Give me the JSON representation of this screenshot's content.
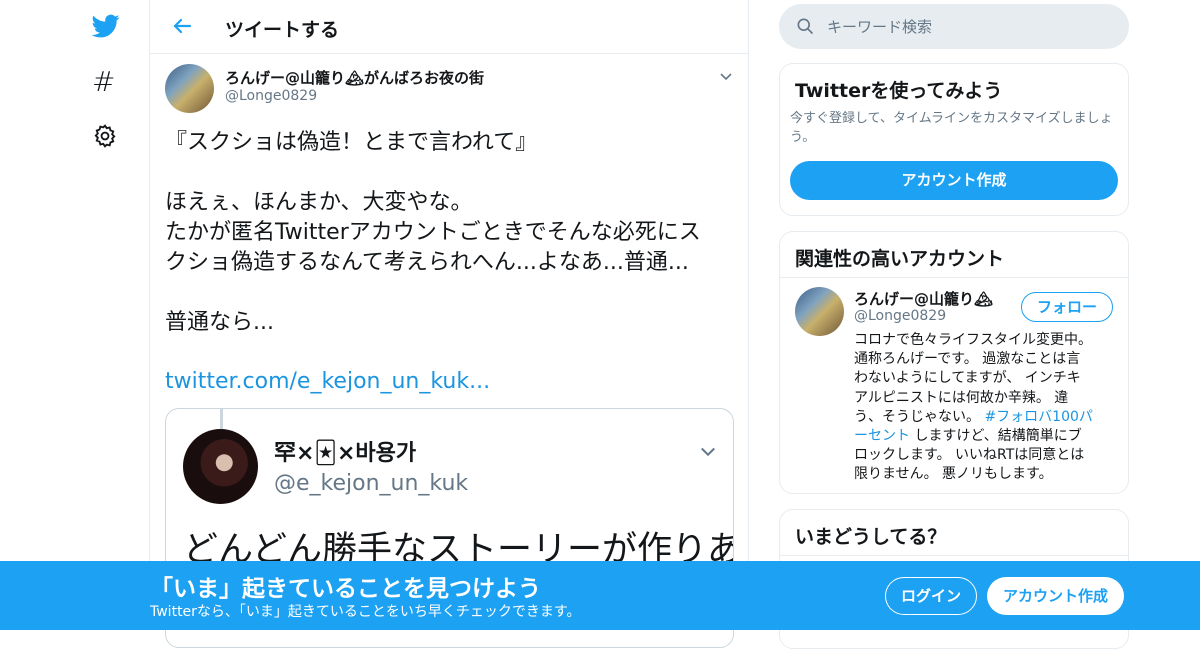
{
  "nav": {
    "logo_icon": "twitter-bird-icon",
    "explore_icon": "hashtag-icon",
    "settings_icon": "gear-icon"
  },
  "header": {
    "back_icon": "back-arrow-icon",
    "title": "ツイートする"
  },
  "tweet": {
    "author_name": "ろんげー@山籠り🏔がんばろお夜の街",
    "author_handle": "@Longe0829",
    "lines": [
      "『スクショは偽造！とまで言われて』",
      "",
      "ほえぇ、ほんまか、大変やな。",
      "たかが匿名Twitterアカウントごときでそんな必死にス",
      "クショ偽造するなんて考えられへん...よなあ...普通...",
      "",
      "普通なら..."
    ],
    "link": "twitter.com/e_kejon_un_kuk..."
  },
  "quoted": {
    "author_name": "罕×🃏×바용가",
    "author_handle": "@e_kejon_un_kuk",
    "text": "どんどん勝手なストーリーが作りあ"
  },
  "search": {
    "placeholder": "キーワード検索"
  },
  "try_panel": {
    "title": "Twitterを使ってみよう",
    "desc": "今すぐ登録して、タイムラインをカスタマイズしましょう。",
    "button": "アカウント作成"
  },
  "related": {
    "title": "関連性の高いアカウント",
    "name": "ろんげー@山籠り🏔",
    "handle": "@Longe0829",
    "follow": "フォロー",
    "bio": [
      "コロナで色々ライフスタイル変更中。",
      "通称ろんげーです。 過激なことは言",
      "わないようにしてますが、 インチキ",
      "アルピニストには何故か辛辣。 違",
      [
        "う、そうじゃない。 ",
        "#フォロバ100パ"
      ],
      [
        "セント",
        " しますけど、結構簡単にブ"
      ],
      "ロックします。 いいねRTは同意とは",
      "限りません。 悪ノリもします。"
    ],
    "bio_line5_a": "う、そうじゃない。 ",
    "bio_line5_tag": "#フォロバ100パ",
    "bio_line6_tag": "ーセント",
    "bio_line6_b": " しますけど、結構簡単にブ"
  },
  "trends": {
    "title": "いまどうしてる？"
  },
  "banner": {
    "title": "「いま」起きていることを見つけよう",
    "subtitle": "Twitterなら、「いま」起きていることをいち早くチェックできます。",
    "login": "ログイン",
    "signup": "アカウント作成"
  },
  "colors": {
    "accent": "#1da1f2",
    "link": "#1b95e0",
    "muted": "#657786"
  }
}
